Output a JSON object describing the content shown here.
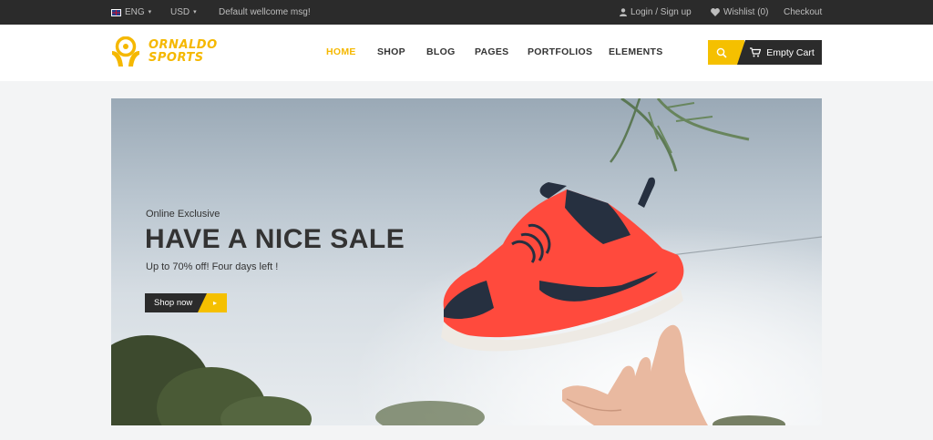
{
  "topbar": {
    "language": "ENG",
    "currency": "USD",
    "welcome": "Default wellcome msg!",
    "login": "Login / Sign up",
    "wishlist": "Wishlist (0)",
    "checkout": "Checkout"
  },
  "header": {
    "logo_line1": "ORNALDO",
    "logo_line2": "SPORTS",
    "nav": [
      "HOME",
      "SHOP",
      "BLOG",
      "PAGES",
      "PORTFOLIOS",
      "ELEMENTS"
    ],
    "active_nav": "HOME",
    "cart_label": "Empty Cart"
  },
  "hero": {
    "eyebrow": "Online Exclusive",
    "title": "HAVE A NICE SALE",
    "subtitle": "Up to 70% off! Four days left !",
    "button_label": "Shop now"
  },
  "colors": {
    "accent": "#f5c000",
    "dark": "#2b2b2b",
    "shoe_red": "#ff4a3d"
  }
}
